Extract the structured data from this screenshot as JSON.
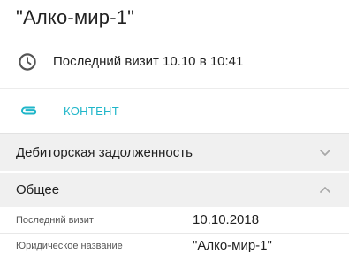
{
  "header": {
    "title": "\"Алко-мир-1\""
  },
  "visit": {
    "icon": "clock-icon",
    "text": "Последний визит 10.10 в 10:41"
  },
  "content": {
    "icon": "paperclip-icon",
    "label": "КОНТЕНТ",
    "accent_color": "#1fb6c9"
  },
  "sections": [
    {
      "title": "Дебиторская задолженность",
      "state": "collapsed",
      "icon": "chevron-down-icon"
    },
    {
      "title": "Общее",
      "state": "expanded",
      "icon": "chevron-up-icon"
    }
  ],
  "general_fields": [
    {
      "key": "Последний визит",
      "value": "10.10.2018"
    },
    {
      "key": "Юридическое название",
      "value": "\"Алко-мир-1\""
    }
  ]
}
